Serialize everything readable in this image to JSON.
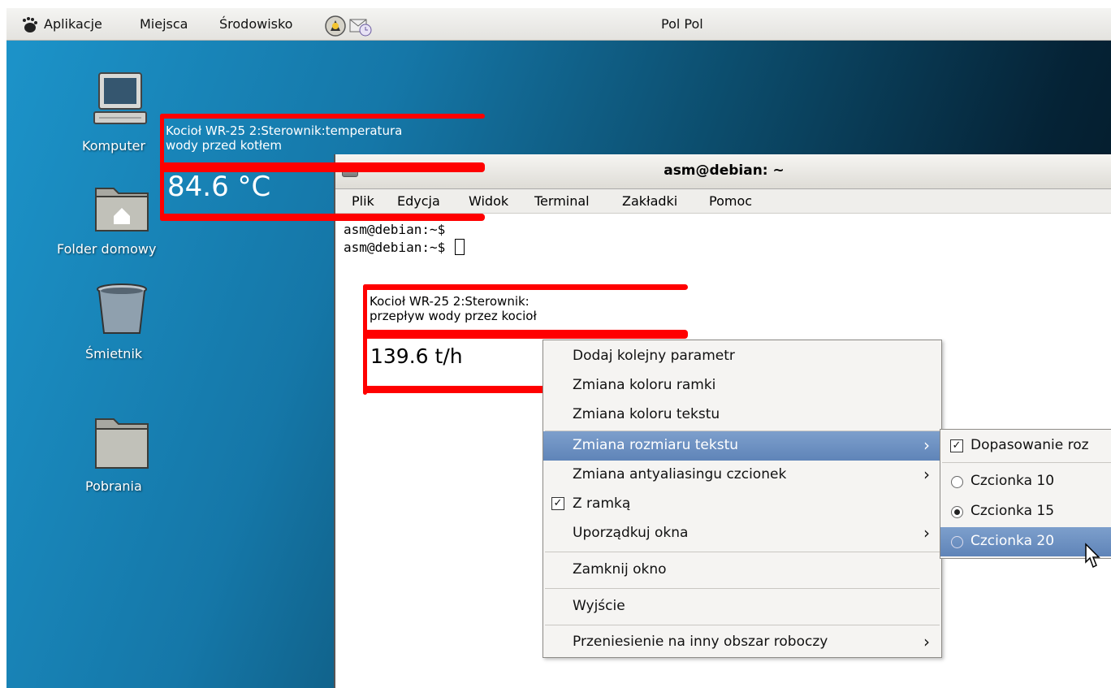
{
  "top_panel": {
    "menus": [
      "Aplikacje",
      "Miejsca",
      "Środowisko"
    ],
    "user_label": "Pol Pol",
    "icons": [
      "gnome-foot-icon",
      "help-icon",
      "mail-clock-icon"
    ]
  },
  "desktop": {
    "icons": [
      {
        "label": "Komputer",
        "icon": "computer-icon"
      },
      {
        "label": "Folder domowy",
        "icon": "home-folder-icon"
      },
      {
        "label": "Śmietnik",
        "icon": "trash-icon"
      },
      {
        "label": "Pobrania",
        "icon": "folder-icon"
      }
    ]
  },
  "widget_temperature": {
    "title": "Kocioł WR-25 2:Sterownik:temperatura\nwody przed kotłem",
    "value": "84.6 °C"
  },
  "terminal": {
    "title": "asm@debian: ~",
    "menu": [
      "Plik",
      "Edycja",
      "Widok",
      "Terminal",
      "Zakładki",
      "Pomoc"
    ],
    "lines": [
      "asm@debian:~$",
      "asm@debian:~$ "
    ]
  },
  "widget_flow": {
    "title": "Kocioł WR-25 2:Sterownik:\nprzepływ wody przez kocioł",
    "value": "139.6 t/h"
  },
  "context_menu": {
    "items": [
      {
        "label": "Dodaj kolejny parametr"
      },
      {
        "label": "Zmiana koloru ramki"
      },
      {
        "label": "Zmiana koloru tekstu"
      },
      {
        "label": "Zmiana rozmiaru tekstu",
        "submenu": true,
        "selected": true
      },
      {
        "label": "Zmiana antyaliasingu czcionek",
        "submenu": true
      },
      {
        "label": "Z ramką",
        "checked": true
      },
      {
        "label": "Uporządkuj okna",
        "submenu": true
      },
      {
        "label": "Zamknij okno"
      },
      {
        "label": "Wyjście"
      },
      {
        "label": "Przeniesienie na inny obszar roboczy",
        "submenu": true
      }
    ]
  },
  "submenu": {
    "items": [
      {
        "label": "Dopasowanie roz",
        "type": "checkbox",
        "checked": true
      },
      {
        "label": "Czcionka 10",
        "type": "radio",
        "checked": false
      },
      {
        "label": "Czcionka 15",
        "type": "radio",
        "checked": true
      },
      {
        "label": "Czcionka 20",
        "type": "radio",
        "checked": false,
        "selected": true
      }
    ]
  },
  "colors": {
    "widget_frame": "#ff0000",
    "menu_highlight": "#6b8dc0",
    "desktop_left": "#1c93c9",
    "desktop_right": "#04131e"
  }
}
